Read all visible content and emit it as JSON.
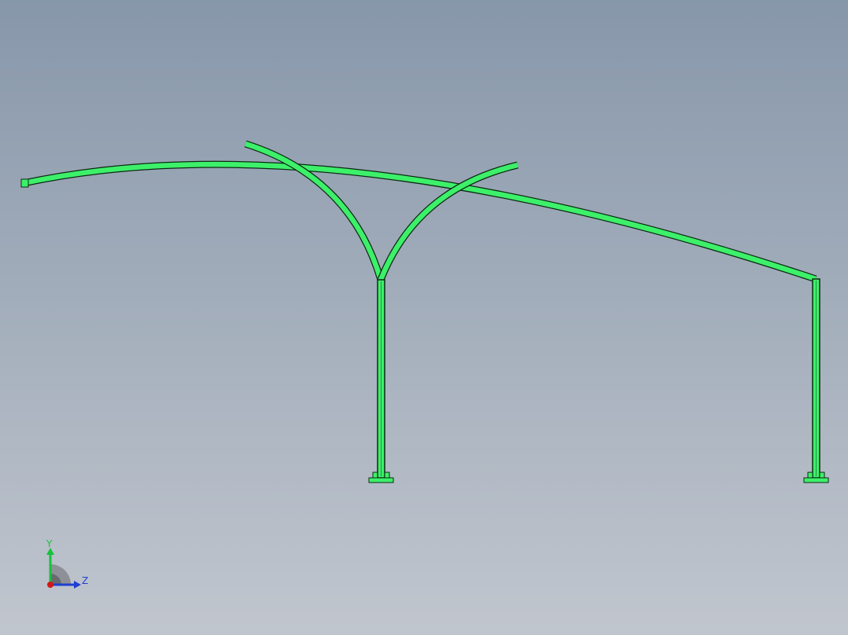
{
  "viewport": {
    "background_top": "#8797aa",
    "background_bottom": "#c1c6ce"
  },
  "model": {
    "member_color": "#3df06a",
    "member_edge_color": "#0c2a12",
    "icon": "canopy-frame-model"
  },
  "triad": {
    "y_label": "Y",
    "z_label": "Z",
    "y_color": "#17c13c",
    "z_color": "#1f3fd0",
    "x_color": "#d01818",
    "icon": "coordinate-triad-icon"
  }
}
